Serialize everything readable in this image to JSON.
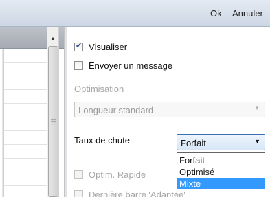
{
  "toolbar": {
    "ok_label": "Ok",
    "cancel_label": "Annuler"
  },
  "options": {
    "visualiser": {
      "label": "Visualiser",
      "checked": true
    },
    "envoyer": {
      "label": "Envoyer un message",
      "checked": false
    }
  },
  "optimisation": {
    "section_label": "Optimisation",
    "select_value": "Longueur standard"
  },
  "taux": {
    "label": "Taux de chute",
    "selected": "Forfait",
    "dropdown_options": [
      "Forfait",
      "Optimisé",
      "Mixte"
    ],
    "highlighted_option": "Mixte"
  },
  "optim_rapide": {
    "label": "Optim. Rapide",
    "checked": false
  },
  "derniere_barre": {
    "label": "Dernière barre 'Adaptée'",
    "checked": false
  },
  "colors": {
    "highlight": "#3399ff",
    "focus_border": "#3a6fb0"
  }
}
